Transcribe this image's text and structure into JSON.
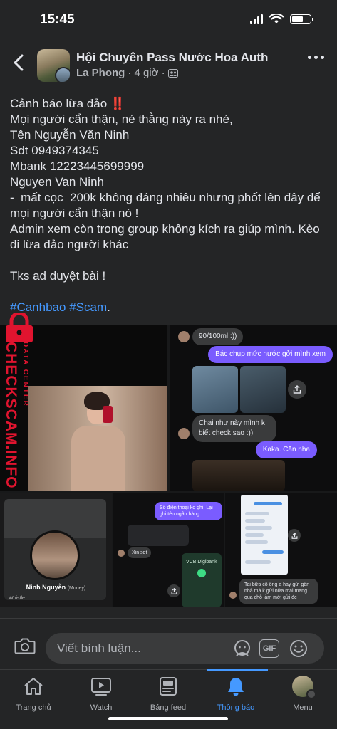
{
  "status_bar": {
    "time": "15:45",
    "battery_level": 0.62
  },
  "header": {
    "group_name": "Hội Chuyên Pass Nước Hoa Auth",
    "author": "La Phong",
    "time_ago": "· 4 giờ ·",
    "privacy_icon": "group-members-icon"
  },
  "post": {
    "lines": [
      "Cảnh báo lừa đảo",
      "Mọi người cẩn thận, né thằng này ra nhé,",
      "Tên Nguyễn Văn Ninh",
      "Sdt 0949374345",
      "Mbank 12223445699999",
      "Nguyen Van Ninh",
      "-  mất cọc  200k không đáng nhiêu nhưng phốt lên đây để",
      "mọi người cẩn thận nó !",
      "Admin xem còn trong group không kích ra giúp mình. Kèo",
      "đi lừa đảo người khác",
      "",
      "Tks ad duyệt bài !",
      ""
    ],
    "warning_emoji": "‼️",
    "hashtags": [
      "#Canhbao",
      "#Scam"
    ],
    "hashtag_suffix": "."
  },
  "media": {
    "watermark": "CHECKSCAM.INFO",
    "watermark_sub": "DATA CENTER",
    "chat1": {
      "msg_in_1": "90/100ml :))",
      "msg_out_1": "Bác chụp mức nước gởi mình xem",
      "msg_in_2": "Chai như này mình k biết check sao :))",
      "msg_out_2": "Kaka. Căn nha"
    },
    "profile": {
      "name": "Ninh Nguyễn",
      "tag": "(Money)",
      "footer": "Whistle"
    },
    "chat2": {
      "msg_out": "Số điện thoại ko ghi. Lại ghi tên ngân hàng",
      "msg_in": "Xin sdt",
      "bank_card": "VCB Digibank"
    },
    "chat3": {
      "msg_in": "Tai bữa cô ông a hay gửi gần nhà mà k gửi nữa mai mang qua chỗ làm mới gửi đc"
    }
  },
  "composer": {
    "placeholder": "Viết bình luận...",
    "gif_label": "GIF"
  },
  "tabs": [
    {
      "label": "Trang chủ",
      "icon": "home-icon"
    },
    {
      "label": "Watch",
      "icon": "video-icon"
    },
    {
      "label": "Bảng feed",
      "icon": "feed-icon"
    },
    {
      "label": "Thông báo",
      "icon": "bell-icon",
      "active": true
    },
    {
      "label": "Menu",
      "icon": "profile-menu-icon"
    }
  ],
  "colors": {
    "accent": "#4599ff",
    "background": "#242526",
    "warning": "#ff3b30",
    "bubble_out": "#7a5cff"
  }
}
